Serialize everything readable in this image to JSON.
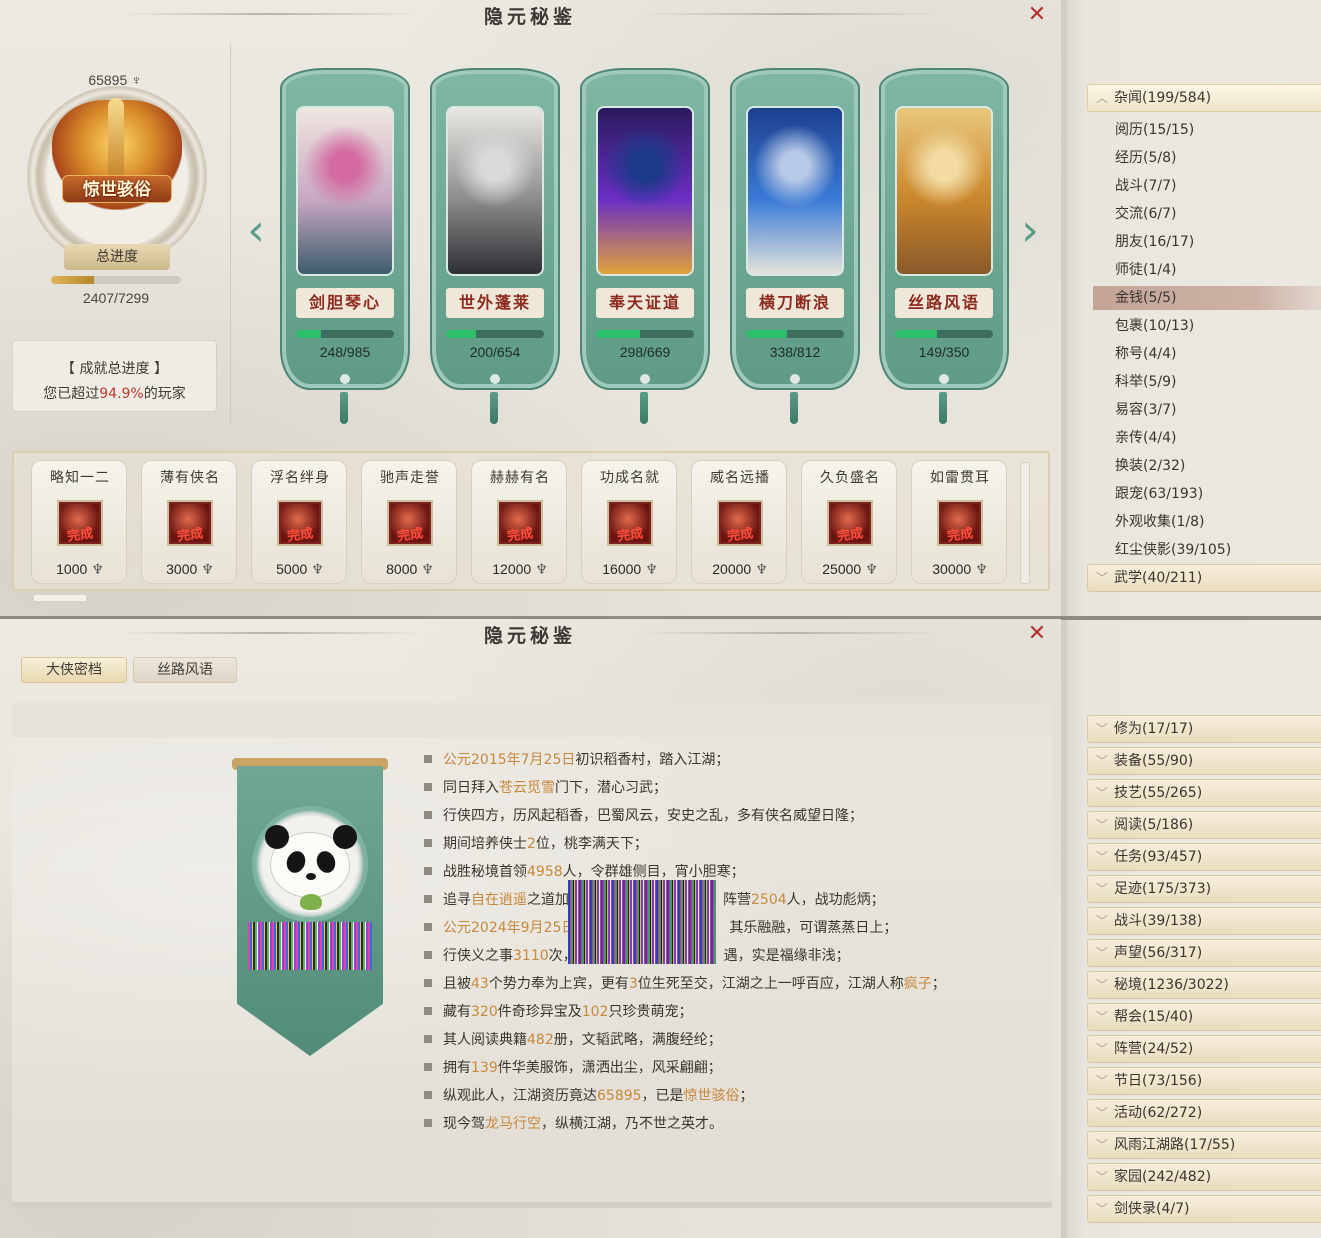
{
  "top_panel": {
    "title": "隐元秘鉴",
    "close_symbol": "✕",
    "rank": {
      "points": "65895",
      "name": "惊世骇俗",
      "overall_label": "总进度",
      "overall_progress_text": "2407/7299",
      "overall_progress_fraction": 0.33
    },
    "summary": {
      "title": "【 成就总进度 】",
      "prefix": "您已超过",
      "percent": "94.9%",
      "suffix": "的玩家"
    },
    "arrows": {
      "left": "‹",
      "right": "›"
    },
    "books": [
      {
        "name": "剑胆琴心",
        "progress": "248/985",
        "fraction": 0.25,
        "palette": [
          "#efe6e0",
          "#c8a8c2",
          "#3c5c6a",
          "#d46aa0"
        ]
      },
      {
        "name": "世外蓬莱",
        "progress": "200/654",
        "fraction": 0.31,
        "palette": [
          "#e9e7e3",
          "#8c8c8c",
          "#2d2f33",
          "#d9d9d9"
        ]
      },
      {
        "name": "奉天证道",
        "progress": "298/669",
        "fraction": 0.45,
        "palette": [
          "#2a1a5e",
          "#6a2fc4",
          "#e2a13c",
          "#1c3a8a"
        ]
      },
      {
        "name": "横刀断浪",
        "progress": "338/812",
        "fraction": 0.42,
        "palette": [
          "#1d3f8e",
          "#3a7ad6",
          "#e6e4dc",
          "#b7c9e6"
        ]
      },
      {
        "name": "丝路风语",
        "progress": "149/350",
        "fraction": 0.43,
        "palette": [
          "#e8c77a",
          "#c9862d",
          "#8a5a2a",
          "#f2dca2"
        ]
      }
    ],
    "milestones": [
      {
        "name": "略知一二",
        "points": "1000",
        "done": "完成"
      },
      {
        "name": "薄有侠名",
        "points": "3000",
        "done": "完成"
      },
      {
        "name": "浮名绊身",
        "points": "5000",
        "done": "完成"
      },
      {
        "name": "驰声走誉",
        "points": "8000",
        "done": "完成"
      },
      {
        "name": "赫赫有名",
        "points": "12000",
        "done": "完成"
      },
      {
        "name": "功成名就",
        "points": "16000",
        "done": "完成"
      },
      {
        "name": "威名远播",
        "points": "20000",
        "done": "完成"
      },
      {
        "name": "久负盛名",
        "points": "25000",
        "done": "完成"
      },
      {
        "name": "如雷贯耳",
        "points": "30000",
        "done": "完成"
      }
    ]
  },
  "sidebar_top": {
    "categories": [
      {
        "label": "杂闻(199/584)",
        "open": true
      },
      {
        "label": "武学(40/211)",
        "open": false
      }
    ],
    "sub_items": [
      {
        "label": "阅历(15/15)",
        "selected": false
      },
      {
        "label": "经历(5/8)",
        "selected": false
      },
      {
        "label": "战斗(7/7)",
        "selected": false
      },
      {
        "label": "交流(6/7)",
        "selected": false
      },
      {
        "label": "朋友(16/17)",
        "selected": false
      },
      {
        "label": "师徒(1/4)",
        "selected": false
      },
      {
        "label": "金钱(5/5)",
        "selected": true
      },
      {
        "label": "包裹(10/13)",
        "selected": false
      },
      {
        "label": "称号(4/4)",
        "selected": false
      },
      {
        "label": "科举(5/9)",
        "selected": false
      },
      {
        "label": "易容(3/7)",
        "selected": false
      },
      {
        "label": "亲传(4/4)",
        "selected": false
      },
      {
        "label": "换装(2/32)",
        "selected": false
      },
      {
        "label": "跟宠(63/193)",
        "selected": false
      },
      {
        "label": "外观收集(1/8)",
        "selected": false
      },
      {
        "label": "红尘侠影(39/105)",
        "selected": false
      }
    ]
  },
  "bottom_panel": {
    "title": "隐元秘鉴",
    "close_symbol": "✕",
    "tabs": [
      {
        "label": "大侠密档",
        "active": true
      },
      {
        "label": "丝路风语",
        "active": false
      }
    ],
    "story": [
      [
        {
          "t": "公元2015年7月25日",
          "h": true
        },
        {
          "t": "初识稻香村，踏入江湖；",
          "h": false
        }
      ],
      [
        {
          "t": "同日拜入",
          "h": false
        },
        {
          "t": "苍云觅雪",
          "h": true
        },
        {
          "t": "门下，潜心习武；",
          "h": false
        }
      ],
      [
        {
          "t": "行侠四方，历风起稻香，巴蜀风云，安史之乱，多有侠名威望日隆；",
          "h": false
        }
      ],
      [
        {
          "t": "期间培养侠士",
          "h": false
        },
        {
          "t": "2",
          "h": true
        },
        {
          "t": "位，桃李满天下；",
          "h": false
        }
      ],
      [
        {
          "t": "战胜秘境首领",
          "h": false
        },
        {
          "t": "4958",
          "h": true
        },
        {
          "t": "人，令群雄侧目，宵小胆寒；",
          "h": false
        }
      ],
      [
        {
          "t": "追寻",
          "h": false
        },
        {
          "t": "自在逍遥",
          "h": true
        },
        {
          "t": "之道加",
          "h": false
        },
        {
          "t": "　　　　　　　　　　　",
          "h": false
        },
        {
          "t": "阵营",
          "h": false
        },
        {
          "t": "2504",
          "h": true
        },
        {
          "t": "人，战功彪炳；",
          "h": false
        }
      ],
      [
        {
          "t": "公元2024年9月25日",
          "h": true
        },
        {
          "t": "　　　　　　　　　　　",
          "h": false
        },
        {
          "t": "其乐融融，可谓蒸蒸日上；",
          "h": false
        }
      ],
      [
        {
          "t": "行侠义之事",
          "h": false
        },
        {
          "t": "3110",
          "h": true
        },
        {
          "t": "次，",
          "h": false
        },
        {
          "t": "　　　　　　　　　　　",
          "h": false
        },
        {
          "t": "遇，实是福缘非浅；",
          "h": false
        }
      ],
      [
        {
          "t": "且被",
          "h": false
        },
        {
          "t": "43",
          "h": true
        },
        {
          "t": "个势力奉为上宾，更有",
          "h": false
        },
        {
          "t": "3",
          "h": true
        },
        {
          "t": "位生死至交，江湖之上一呼百应，江湖人称",
          "h": false
        },
        {
          "t": "疯子",
          "h": true
        },
        {
          "t": "；",
          "h": false
        }
      ],
      [
        {
          "t": "藏有",
          "h": false
        },
        {
          "t": "320",
          "h": true
        },
        {
          "t": "件奇珍异宝及",
          "h": false
        },
        {
          "t": "102",
          "h": true
        },
        {
          "t": "只珍贵萌宠；",
          "h": false
        }
      ],
      [
        {
          "t": "其人阅读典籍",
          "h": false
        },
        {
          "t": "482",
          "h": true
        },
        {
          "t": "册，文韬武略，满腹经纶；",
          "h": false
        }
      ],
      [
        {
          "t": "拥有",
          "h": false
        },
        {
          "t": "139",
          "h": true
        },
        {
          "t": "件华美服饰，潇洒出尘，风采翩翩；",
          "h": false
        }
      ],
      [
        {
          "t": "纵观此人，江湖资历竟达",
          "h": false
        },
        {
          "t": "65895",
          "h": true
        },
        {
          "t": "，已是",
          "h": false
        },
        {
          "t": "惊世骇俗",
          "h": true
        },
        {
          "t": "；",
          "h": false
        }
      ],
      [
        {
          "t": "现今驾",
          "h": false
        },
        {
          "t": "龙马行空",
          "h": true
        },
        {
          "t": "，纵横江湖，乃不世之英才。",
          "h": false
        }
      ]
    ]
  },
  "sidebar_bottom": {
    "categories": [
      {
        "label": "修为(17/17)"
      },
      {
        "label": "装备(55/90)"
      },
      {
        "label": "技艺(55/265)"
      },
      {
        "label": "阅读(5/186)"
      },
      {
        "label": "任务(93/457)"
      },
      {
        "label": "足迹(175/373)"
      },
      {
        "label": "战斗(39/138)"
      },
      {
        "label": "声望(56/317)"
      },
      {
        "label": "秘境(1236/3022)"
      },
      {
        "label": "帮会(15/40)"
      },
      {
        "label": "阵营(24/52)"
      },
      {
        "label": "节日(73/156)"
      },
      {
        "label": "活动(62/272)"
      },
      {
        "label": "风雨江湖路(17/55)"
      },
      {
        "label": "家园(242/482)"
      },
      {
        "label": "剑侠录(4/7)"
      }
    ]
  },
  "icons": {
    "close": "close-icon",
    "coin": "coin-icon",
    "arrow_left": "arrow-left-icon",
    "arrow_right": "arrow-right-icon",
    "chevron": "chevron-icon"
  },
  "colors": {
    "accent_green": "#5b9c89",
    "highlight_text": "#c9883a",
    "close_red": "#b3312e",
    "progress_green": "#2fbf6b",
    "selected_row": "#c3a597"
  }
}
